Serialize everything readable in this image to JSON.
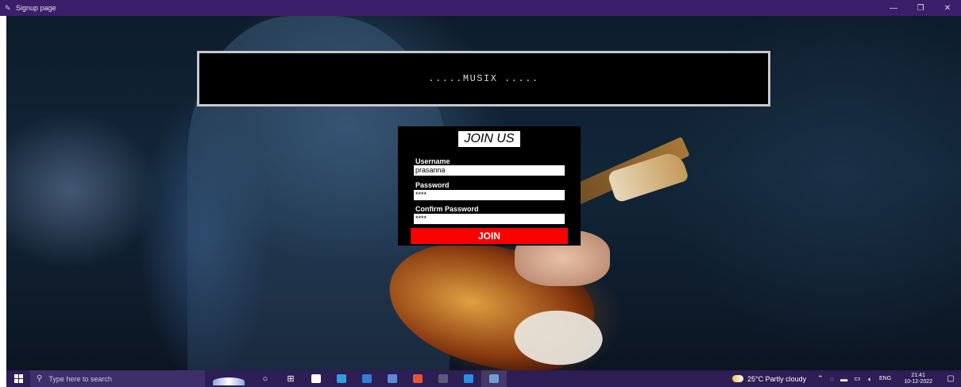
{
  "window": {
    "title": "Signup page",
    "minimize_glyph": "—",
    "maximize_glyph": "❐",
    "close_glyph": "✕",
    "icon": "feather-icon"
  },
  "banner": {
    "text": ".....MUSIX ....."
  },
  "signup": {
    "heading": "JOIN US",
    "username_label": "Username",
    "username_value": "prasanna",
    "password_label": "Password",
    "password_value": "****",
    "confirm_label": "Confirm Password",
    "confirm_value": "****",
    "join_button": "JOIN"
  },
  "colors": {
    "titlebar": "#3c1f6a",
    "join_button": "#fa0000",
    "taskbar": "#2d1e55"
  },
  "taskbar": {
    "search_placeholder": "Type here to search",
    "apps": [
      {
        "name": "cortana-icon",
        "glyph": "○",
        "color": "#ffffff"
      },
      {
        "name": "task-view-icon",
        "glyph": "⊞",
        "color": "#ffffff"
      },
      {
        "name": "file-icon",
        "glyph": "",
        "color": "#ffffff"
      },
      {
        "name": "edge-icon",
        "glyph": "",
        "color": "#2aa0e0"
      },
      {
        "name": "mail-icon",
        "glyph": "",
        "color": "#2f7fd6"
      },
      {
        "name": "calculator-icon",
        "glyph": "",
        "color": "#5b8ad8"
      },
      {
        "name": "chrome-icon",
        "glyph": "",
        "color": "#e8543a"
      },
      {
        "name": "terminal-icon",
        "glyph": "",
        "color": "#5a5a7a"
      },
      {
        "name": "vscode-icon",
        "glyph": "",
        "color": "#2b8ee0"
      },
      {
        "name": "python-icon",
        "glyph": "",
        "color": "#6fa0d0"
      }
    ],
    "weather_text": "25°C  Partly cloudy",
    "language": "ENG",
    "time": "21:41",
    "date": "10-12-2022"
  }
}
